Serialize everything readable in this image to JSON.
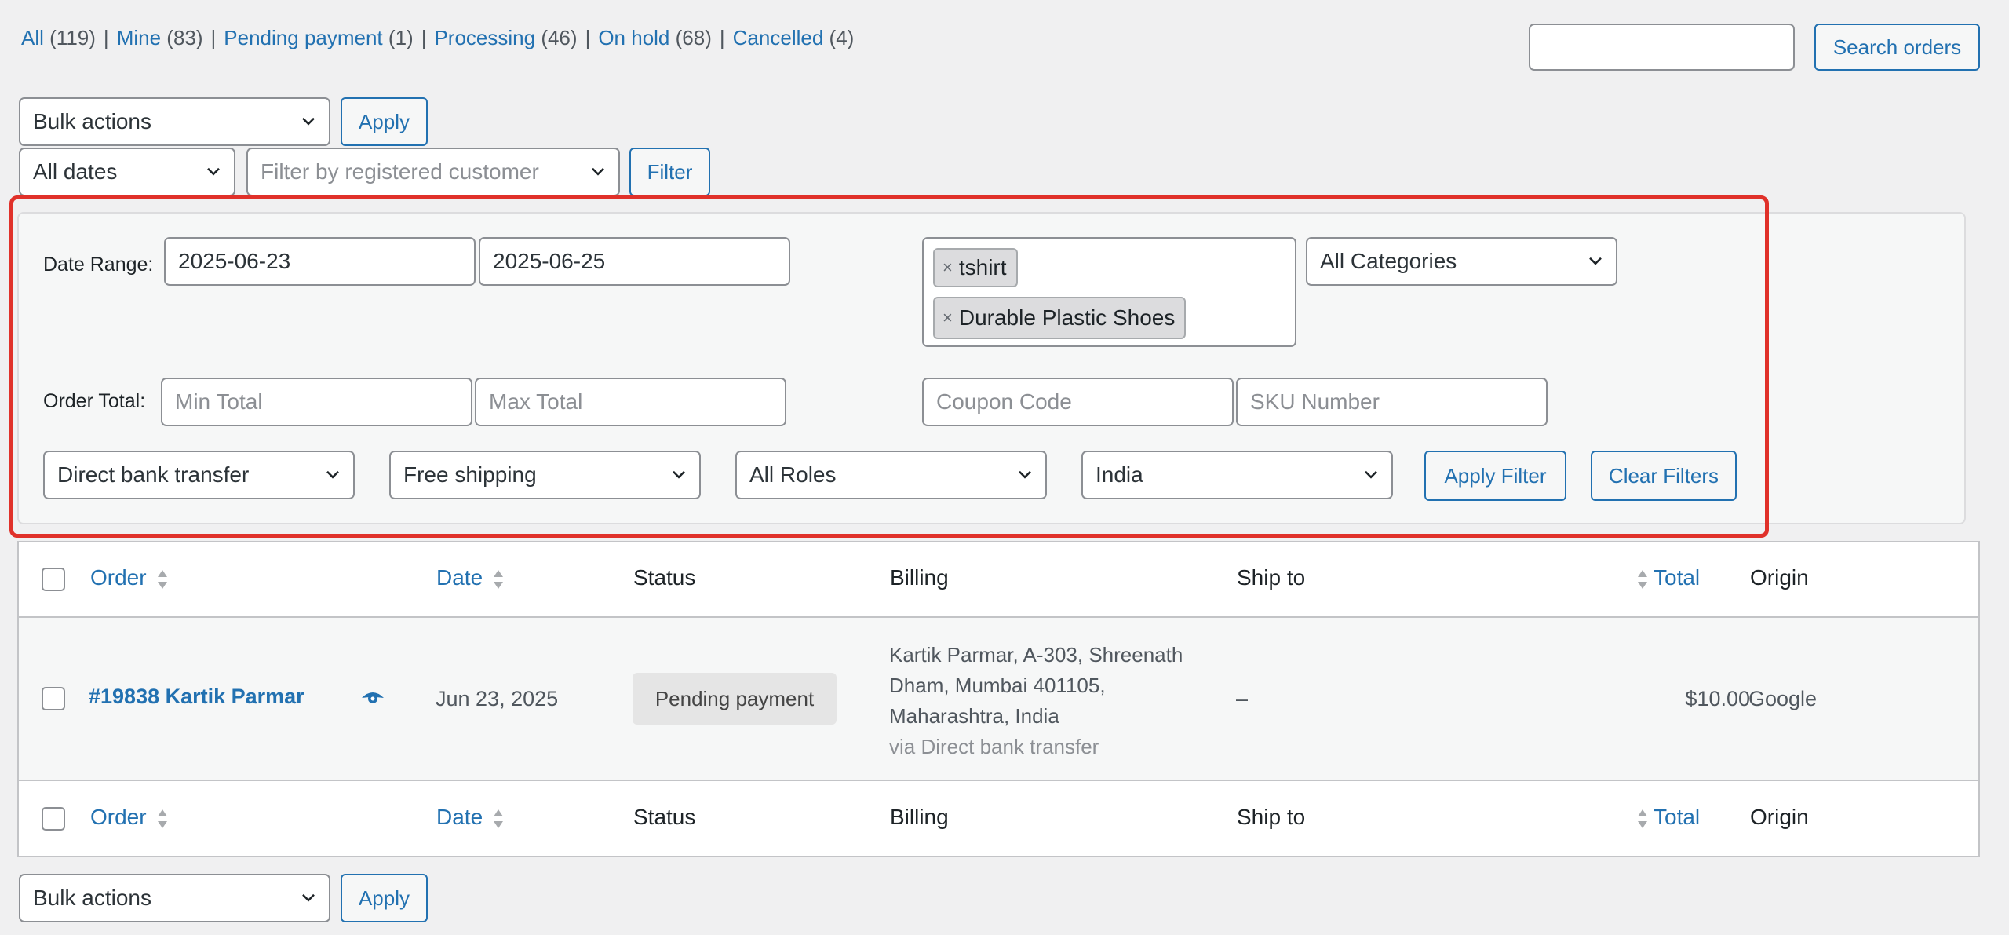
{
  "status_links": [
    {
      "label": "All",
      "count": "(119)"
    },
    {
      "label": "Mine",
      "count": "(83)"
    },
    {
      "label": "Pending payment",
      "count": "(1)"
    },
    {
      "label": "Processing",
      "count": "(46)"
    },
    {
      "label": "On hold",
      "count": "(68)"
    },
    {
      "label": "Cancelled",
      "count": "(4)"
    }
  ],
  "search": {
    "value": "",
    "button": "Search orders"
  },
  "bulk_top": {
    "selected": "Bulk actions",
    "apply": "Apply"
  },
  "filters_top": {
    "dates": "All dates",
    "customer_placeholder": "Filter by registered customer",
    "filter": "Filter"
  },
  "panel": {
    "date_range_label": "Date Range:",
    "date_from": "2025-06-23",
    "date_to": "2025-06-25",
    "products": [
      "tshirt",
      "Durable Plastic Shoes"
    ],
    "tag_remove": "×",
    "categories": "All Categories",
    "order_total_label": "Order Total:",
    "min_total_placeholder": "Min Total",
    "max_total_placeholder": "Max Total",
    "coupon_placeholder": "Coupon Code",
    "sku_placeholder": "SKU Number",
    "payment_method": "Direct bank transfer",
    "shipping_method": "Free shipping",
    "roles": "All Roles",
    "country": "India",
    "apply_filter": "Apply Filter",
    "clear_filters": "Clear Filters"
  },
  "table": {
    "columns": {
      "order": "Order",
      "date": "Date",
      "status": "Status",
      "billing": "Billing",
      "ship_to": "Ship to",
      "total": "Total",
      "origin": "Origin"
    },
    "rows": [
      {
        "order": "#19838 Kartik Parmar",
        "date": "Jun 23, 2025",
        "status": "Pending payment",
        "billing_lines": [
          "Kartik Parmar, A-303, Shreenath",
          "Dham, Mumbai 401105,",
          "Maharashtra, India"
        ],
        "billing_via": "via Direct bank transfer",
        "ship_to": "–",
        "total": "$10.00",
        "origin": "Google"
      }
    ]
  },
  "bulk_bottom": {
    "selected": "Bulk actions",
    "apply": "Apply"
  }
}
